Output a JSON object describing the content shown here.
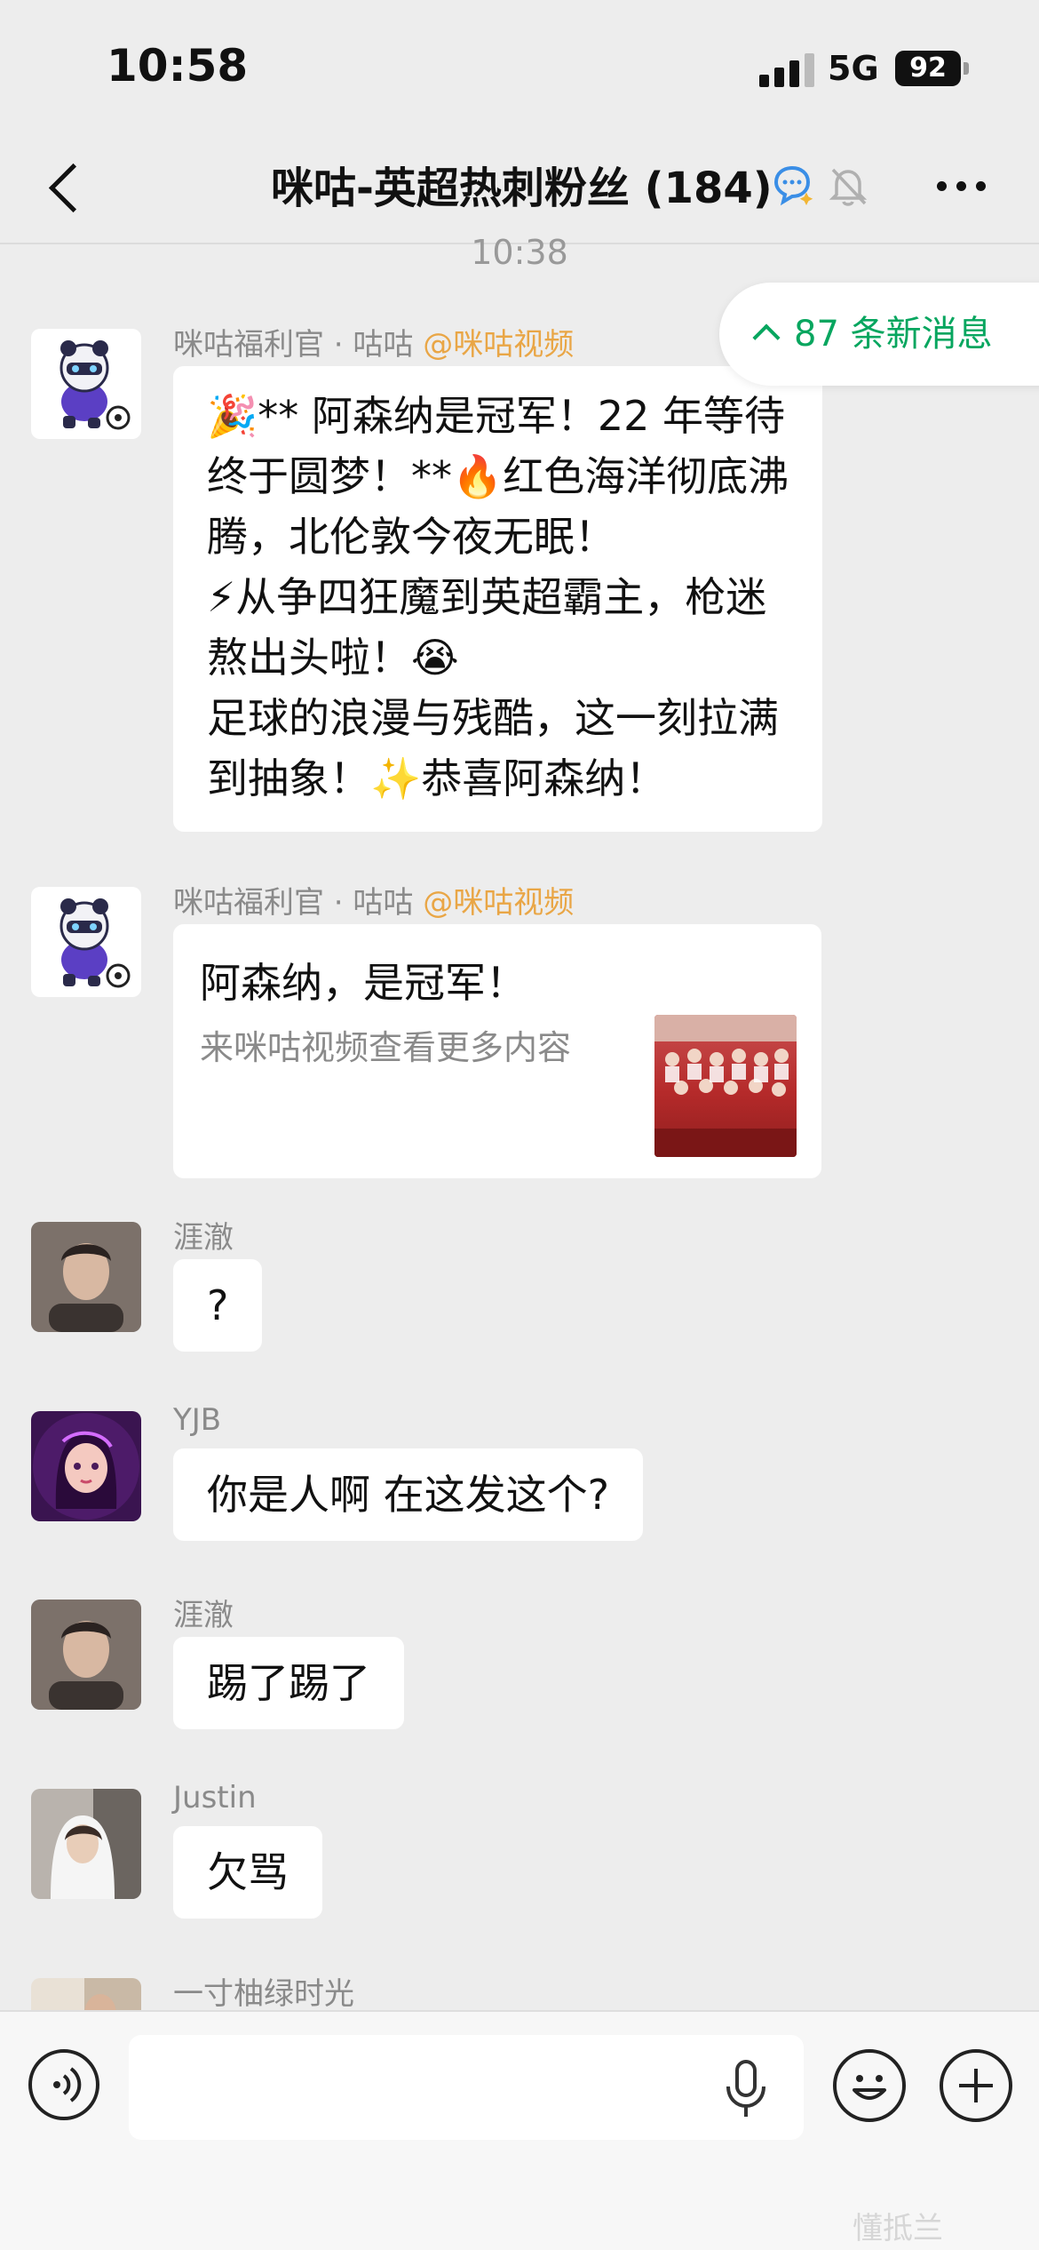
{
  "status_bar": {
    "time": "10:58",
    "network": "5G",
    "battery": "92"
  },
  "nav": {
    "title": "咪咕-英超热刺粉丝 (184)"
  },
  "timestamp": "10:38",
  "new_messages": {
    "label": "87 条新消息"
  },
  "messages": [
    {
      "sender": "咪咕福利官 · 咕咕",
      "at": "@咪咕视频",
      "lines": [
        "🎉** 阿森纳是冠军！22 年等待",
        "终于圆梦！**🔥红色海洋彻底沸",
        "腾，北伦敦今夜无眠！",
        "⚡从争四狂魔到英超霸主，枪迷",
        "熬出头啦！😭",
        "足球的浪漫与残酷，这一刻拉满",
        "到抽象！✨恭喜阿森纳！"
      ]
    },
    {
      "sender": "咪咕福利官 · 咕咕",
      "at": "@咪咕视频",
      "card_title": "阿森纳，是冠军！",
      "card_desc": "来咪咕视频查看更多内容"
    },
    {
      "sender": "涯澈",
      "text": "?"
    },
    {
      "sender": "YJB",
      "text": "你是人啊 在这发这个?"
    },
    {
      "sender": "涯澈",
      "text": "踢了踢了"
    },
    {
      "sender": "Justin",
      "text": "欠骂"
    },
    {
      "sender": "一寸柚绿时光"
    }
  ],
  "watermark": "懂抵兰",
  "colors": {
    "accent_green": "#07a65f",
    "mention_orange": "#e9a646",
    "background": "#ededed"
  },
  "icons": [
    "back-icon",
    "chat-bubble-icon",
    "mute-bell-icon",
    "more-icon",
    "chevron-up-icon",
    "voice-icon",
    "mic-icon",
    "emoji-icon",
    "plus-icon"
  ]
}
